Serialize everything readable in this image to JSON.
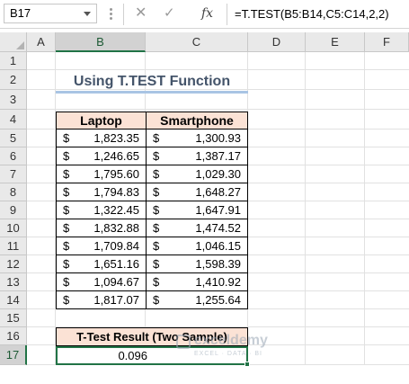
{
  "formula_bar": {
    "name_box": "B17",
    "formula": "=T.TEST(B5:B14,C5:C14,2,2)",
    "cancel_icon": "✕",
    "enter_icon": "✓",
    "fx_label": "fx"
  },
  "columns": [
    "A",
    "B",
    "C",
    "D",
    "E",
    "F"
  ],
  "rows": [
    "1",
    "2",
    "3",
    "4",
    "5",
    "6",
    "7",
    "8",
    "9",
    "10",
    "11",
    "12",
    "13",
    "14",
    "15",
    "16",
    "17"
  ],
  "sheet": {
    "title": "Using T.TEST Function",
    "headers": [
      "Laptop",
      "Smartphone"
    ],
    "currency": "$",
    "data": [
      [
        "1,823.35",
        "1,300.93"
      ],
      [
        "1,246.65",
        "1,387.17"
      ],
      [
        "1,795.60",
        "1,029.30"
      ],
      [
        "1,794.83",
        "1,648.27"
      ],
      [
        "1,322.45",
        "1,647.91"
      ],
      [
        "1,832.88",
        "1,474.52"
      ],
      [
        "1,709.84",
        "1,046.15"
      ],
      [
        "1,651.16",
        "1,598.39"
      ],
      [
        "1,094.67",
        "1,410.92"
      ],
      [
        "1,817.07",
        "1,255.64"
      ]
    ],
    "result_label": "T-Test Result (Two Sample)",
    "result_value": "0.096"
  },
  "watermark": {
    "name": "exceldemy",
    "tagline": "EXCEL · DATA · BI"
  },
  "colors": {
    "header_fill": "#fbe2d5",
    "title_color": "#44546a",
    "selection": "#217346"
  }
}
